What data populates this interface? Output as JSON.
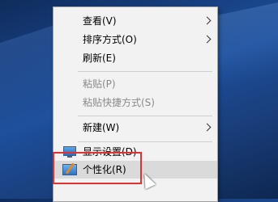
{
  "context_menu": {
    "items": [
      {
        "label": "查看(V)",
        "submenu": true,
        "enabled": true
      },
      {
        "label": "排序方式(O)",
        "submenu": true,
        "enabled": true
      },
      {
        "label": "刷新(E)",
        "submenu": false,
        "enabled": true
      },
      {
        "label": "粘贴(P)",
        "submenu": false,
        "enabled": false
      },
      {
        "label": "粘贴快捷方式(S)",
        "submenu": false,
        "enabled": false
      },
      {
        "label": "新建(W)",
        "submenu": true,
        "enabled": true
      },
      {
        "label": "显示设置(D)",
        "submenu": false,
        "enabled": true,
        "icon": "display-icon"
      },
      {
        "label": "个性化(R)",
        "submenu": false,
        "enabled": true,
        "icon": "personalize-icon",
        "hovered": true
      }
    ]
  },
  "colors": {
    "highlight_box": "#e0322f",
    "menu_background": "#f2f2f2",
    "desktop_blue": "#1d4f9c"
  }
}
